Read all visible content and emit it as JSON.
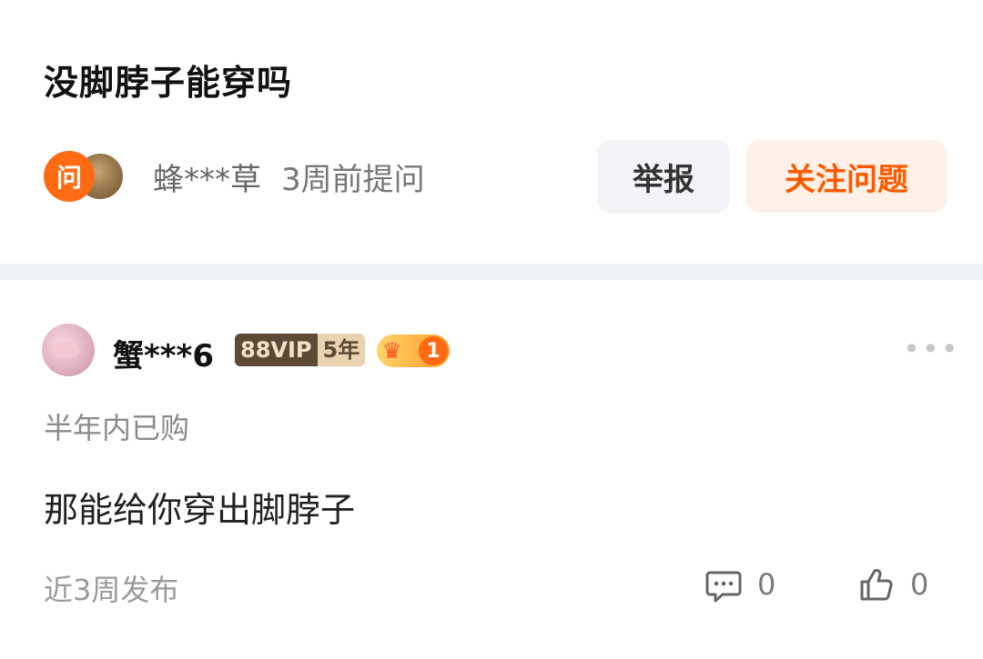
{
  "question": {
    "title": "没脚脖子能穿吗",
    "badge": "问",
    "asker_name": "蜂***草",
    "ask_time": "3周前提问",
    "report_label": "举报",
    "follow_label": "关注问题"
  },
  "answer": {
    "user_name": "蟹***6",
    "vip_label": "88VIP",
    "vip_years": "5年",
    "rank": "1",
    "purchase_note": "半年内已购",
    "text": "那能给你穿出脚脖子",
    "time": "近3周发布",
    "comment_count": "0",
    "like_count": "0"
  },
  "colors": {
    "accent": "#ff5a00",
    "follow_bg": "#fff1e8",
    "report_bg": "#f2f4f7",
    "divider": "#eef2f5"
  },
  "icons": [
    "comment-icon",
    "thumbs-up-icon",
    "more-icon",
    "crown-icon"
  ]
}
